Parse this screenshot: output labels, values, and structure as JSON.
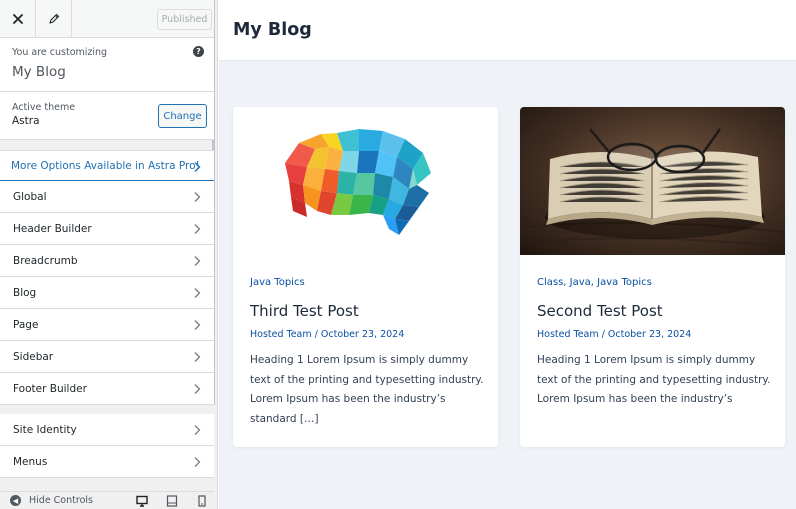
{
  "topbar": {
    "published_label": "Published"
  },
  "customizing": {
    "label": "You are customizing",
    "site_name": "My Blog"
  },
  "theme": {
    "label": "Active theme",
    "name": "Astra",
    "change_label": "Change"
  },
  "promo": {
    "label": "More Options Available in Astra Pro!"
  },
  "menu_group_1": [
    {
      "label": "Global"
    },
    {
      "label": "Header Builder"
    },
    {
      "label": "Breadcrumb"
    },
    {
      "label": "Blog"
    },
    {
      "label": "Page"
    },
    {
      "label": "Sidebar"
    },
    {
      "label": "Footer Builder"
    }
  ],
  "menu_group_2": [
    {
      "label": "Site Identity"
    },
    {
      "label": "Menus"
    }
  ],
  "bottom": {
    "hide_controls": "Hide Controls"
  },
  "preview": {
    "site_title": "My Blog",
    "posts": [
      {
        "categories": "Java Topics",
        "title": "Third Test Post",
        "author": "Hosted Team",
        "date": "October 23, 2024",
        "excerpt": "Heading 1 Lorem Ipsum is simply dummy text of the printing and typesetting industry. Lorem Ipsum has been the industry’s standard […]"
      },
      {
        "categories": "Class, Java, Java Topics",
        "title": "Second Test Post",
        "author": "Hosted Team",
        "date": "October 23, 2024",
        "excerpt": "Heading 1 Lorem Ipsum is simply dummy text of the printing and typesetting industry. Lorem Ipsum has been the industry’s"
      }
    ]
  },
  "colors": {
    "accent": "#2271b1",
    "link": "#0a4fa0",
    "preview_bg": "#eff3f7"
  }
}
